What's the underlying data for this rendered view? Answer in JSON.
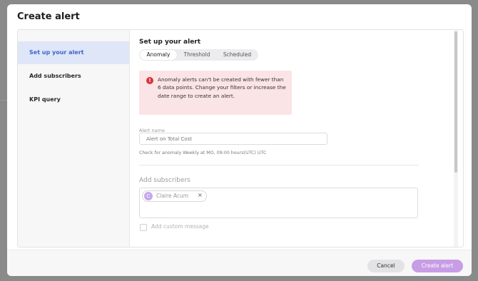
{
  "modal": {
    "title": "Create alert"
  },
  "sidebar": {
    "items": [
      {
        "label": "Set up your alert",
        "active": true
      },
      {
        "label": "Add subscribers",
        "active": false
      },
      {
        "label": "KPI query",
        "active": false
      }
    ]
  },
  "setup": {
    "title": "Set up your alert",
    "alert_types": [
      {
        "label": "Anomaly",
        "selected": true
      },
      {
        "label": "Threshold",
        "selected": false
      },
      {
        "label": "Scheduled",
        "selected": false
      }
    ],
    "error_icon": "exclamation-icon",
    "error_message": "Anomaly alerts can't be created with fewer than 6 data points. Change your filters or increase the date range to create an alert.",
    "alert_name_label": "Alert name",
    "alert_name_placeholder": "Alert on Total Cost",
    "schedule_note": "Check for anomaly Weekly at MO, 09:00 hours(UTC) UTC"
  },
  "subscribers": {
    "title": "Add subscribers",
    "chips": [
      {
        "initial": "C",
        "name": "Claire Acum",
        "close": "×"
      }
    ],
    "custom_message_label": "Add custom message"
  },
  "footer": {
    "cancel_label": "Cancel",
    "create_label": "Create alert"
  },
  "colors": {
    "accent": "#3e63d3",
    "primary_button": "#c79de6",
    "error_bg": "#fbe4e5",
    "error_icon": "#d9343a"
  }
}
